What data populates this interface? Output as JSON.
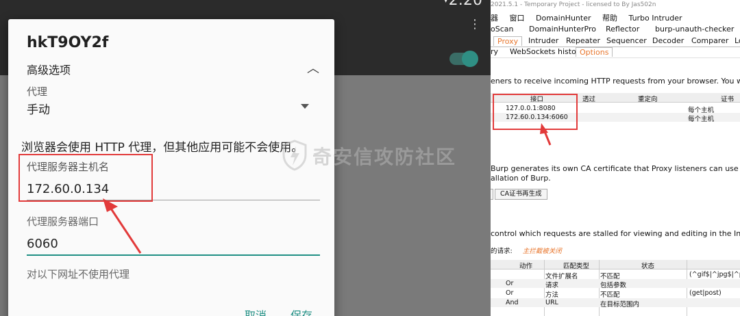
{
  "android": {
    "status_time": "2:20",
    "dialog_title": "hkT9OY2f",
    "advanced_label": "高级选项",
    "proxy_label": "代理",
    "proxy_value": "手动",
    "note": "浏览器会使用 HTTP 代理，但其他应用可能不会使用。",
    "host_label": "代理服务器主机名",
    "host_value": "172.60.0.134",
    "port_label": "代理服务器端口",
    "port_value": "6060",
    "bypass_label": "对以下网址不使用代理",
    "cancel_label": "取消",
    "save_label": "保存",
    "accent_color": "#1f8f84",
    "highlight_color": "#e23a3a"
  },
  "watermark": "奇安信攻防社区",
  "burp": {
    "title_bar": "2021.5.1 - Temporary Project - licensed to By Jas502n",
    "menu": [
      "器",
      "窗口",
      "DomainHunter",
      "帮助",
      "Turbo Intruder"
    ],
    "tabs_row1": [
      "oScan",
      "DomainHunterPro",
      "Reflector",
      "burp-unauth-checker"
    ],
    "tabs_row2": [
      "Proxy",
      "Intruder",
      "Repeater",
      "Sequencer",
      "Decoder",
      "Comparer",
      "Lo"
    ],
    "tabs_row3": [
      "ry",
      "WebSockets history",
      "Options"
    ],
    "listeners_desc": "eners to receive incoming HTTP requests from your browser. You will need to configu",
    "listeners_headers": [
      " ",
      "接口",
      "透过",
      "重定向",
      "证书"
    ],
    "listeners_rows": [
      {
        "iface": "127.0.0.1:8080",
        "cert": "每个主机"
      },
      {
        "iface": "172.60.0.134:6060",
        "cert": "每个主机"
      }
    ],
    "ca_desc_1": "Burp generates its own CA certificate that Proxy listeners can use when negotiating T",
    "ca_desc_2": "allation of Burp.",
    "ca_regen_button": "CA证书再生成",
    "intercept_desc": "control which requests are stalled for viewing and editing in the Intercept tab.",
    "intercept_label": "的请求:",
    "intercept_master": "主拦截被关闭",
    "rules_headers": [
      "动作",
      "匹配类型",
      "状态"
    ],
    "rules_rows": [
      {
        "op": "",
        "match": "文件扩展名",
        "rel": "不匹配",
        "cond": "(^gif$|^jpg$|^pn"
      },
      {
        "op": "Or",
        "match": "请求",
        "rel": "包括参数",
        "cond": ""
      },
      {
        "op": "Or",
        "match": "方法",
        "rel": "不匹配",
        "cond": "(get|post)"
      },
      {
        "op": "And",
        "match": "URL",
        "rel": "在目标范围内",
        "cond": ""
      }
    ]
  }
}
